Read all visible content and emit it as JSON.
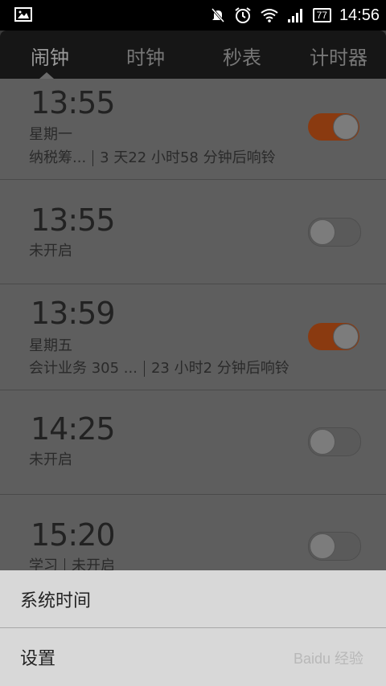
{
  "statusbar": {
    "time": "14:56",
    "battery": "77",
    "icons": [
      "image-icon",
      "mute-icon",
      "alarm-icon",
      "wifi-icon",
      "signal-icon",
      "battery-icon"
    ]
  },
  "tabs": [
    {
      "label": "闹钟",
      "active": true
    },
    {
      "label": "时钟",
      "active": false
    },
    {
      "label": "秒表",
      "active": false
    },
    {
      "label": "计时器",
      "active": false
    }
  ],
  "alarms": [
    {
      "time": "13:55",
      "line1": "星期一",
      "note": "纳税筹...",
      "countdown": "3 天22 小时58 分钟后响铃",
      "on": true
    },
    {
      "time": "13:55",
      "line1": "未开启",
      "on": false
    },
    {
      "time": "13:59",
      "line1": "星期五",
      "note": "会计业务 305 ...",
      "countdown": "23 小时2 分钟后响铃",
      "on": true
    },
    {
      "time": "14:25",
      "line1": "未开启",
      "on": false
    },
    {
      "time": "15:20",
      "line1_a": "学习",
      "line1_b": "未开启",
      "on": false
    }
  ],
  "menu": {
    "items": [
      "系统时间",
      "设置"
    ]
  },
  "watermark": "Baidu 经验"
}
